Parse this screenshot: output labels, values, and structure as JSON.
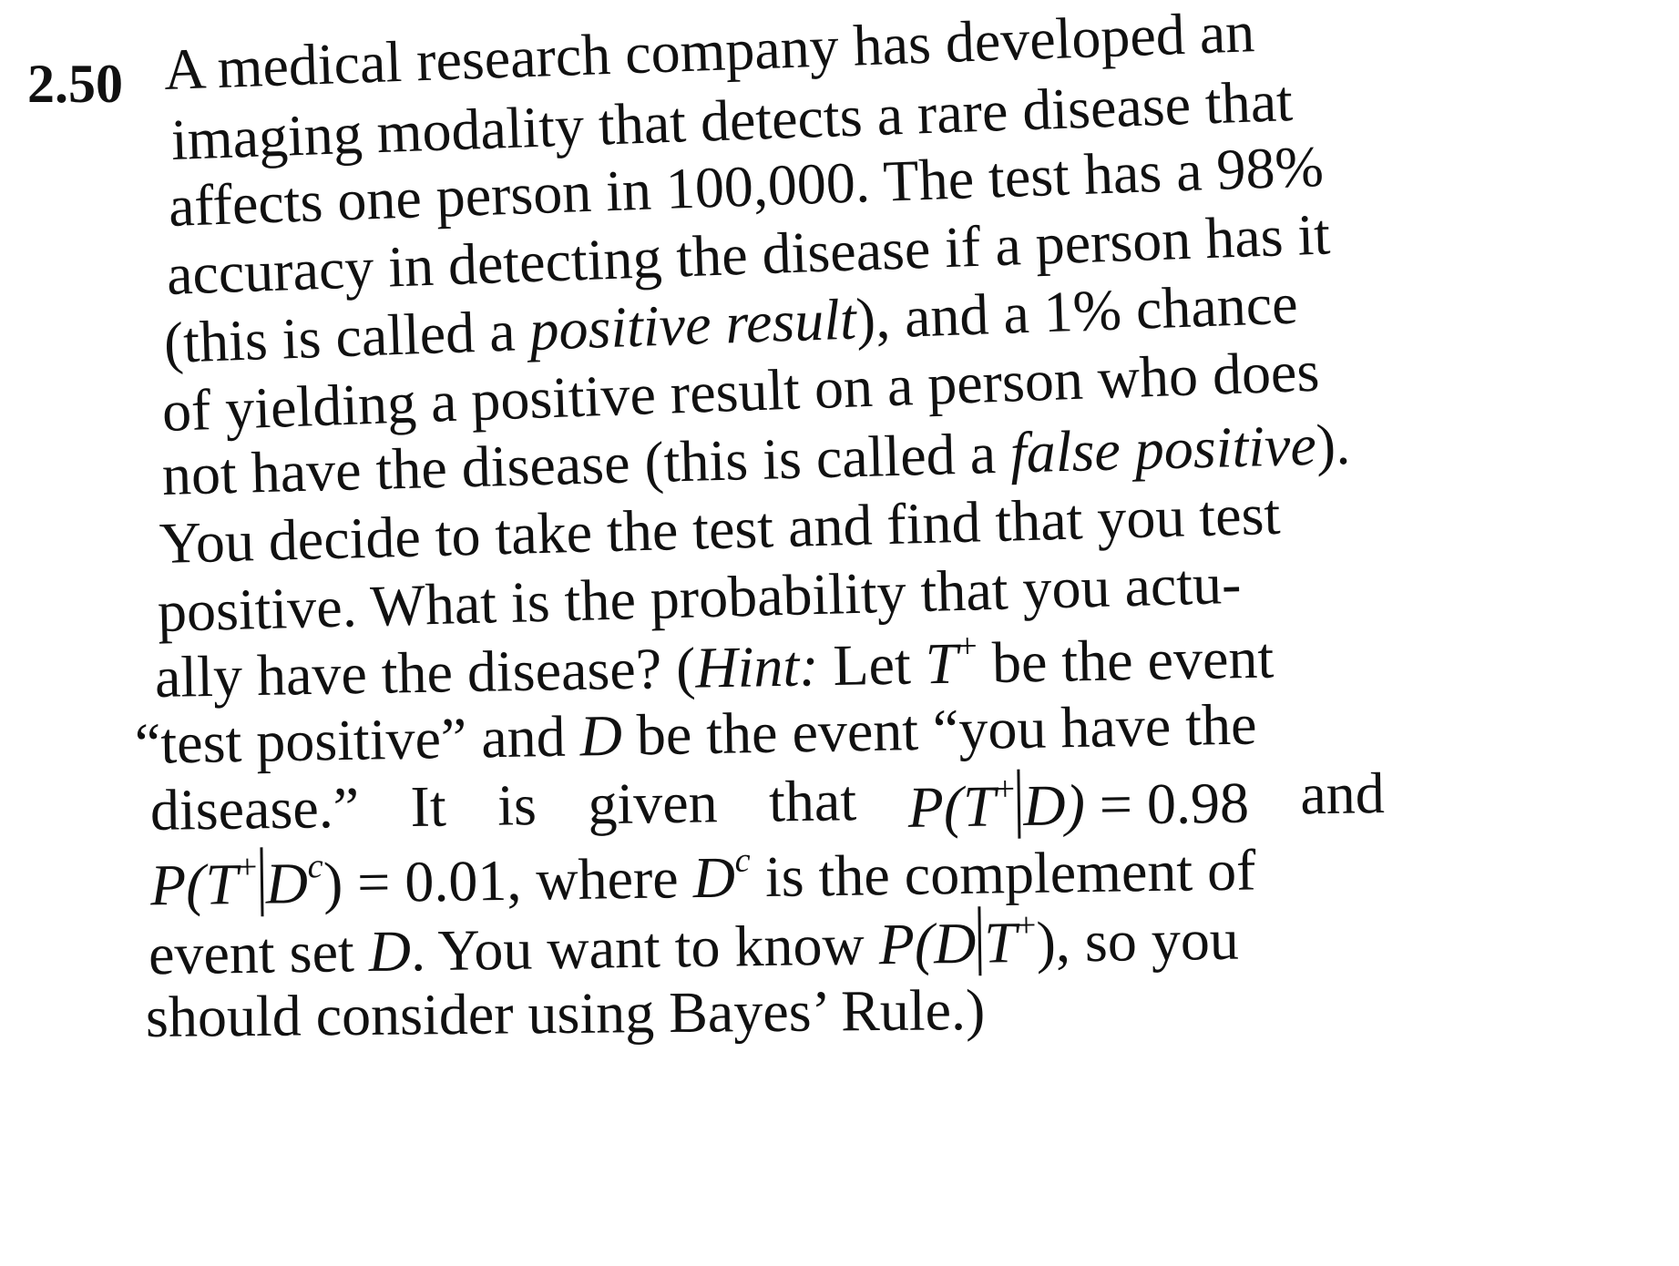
{
  "problem": {
    "number": "2.50",
    "lines": {
      "l1": "A medical research company has developed an",
      "l2": "imaging modality that detects a rare disease that",
      "l3": "affects one person in 100,000. The test has a 98%",
      "l4": "accuracy in detecting the disease if a person has it",
      "l5_a": "(this is called a ",
      "l5_b": "positive result",
      "l5_c": "), and a 1% chance",
      "l6": "of yielding a positive result on a person who does",
      "l7_a": "not have the disease (this is called a ",
      "l7_b": "false positive",
      "l7_c": ").",
      "l8": "You decide to take the test and find that you test",
      "l9": "positive. What is the probability that you actu-",
      "l10_a": "ally have the disease? (",
      "l10_b": "Hint:",
      "l10_c": " Let ",
      "l10_d": "T",
      "l10_e": "+",
      "l10_f": " be the event",
      "l11_a": "“test positive” and ",
      "l11_b": "D",
      "l11_c": " be the event “you have the",
      "l12_w1": "disease.”",
      "l12_w2": "It",
      "l12_w3": "is",
      "l12_w4": "given",
      "l12_w5": "that",
      "l12_f1": "P(T",
      "l12_f2": "+",
      "l12_f3": "D)",
      "l12_f4": "= 0.98",
      "l12_w6": "and",
      "l13_f1": "P(T",
      "l13_f2": "+",
      "l13_f3": "D",
      "l13_f4": "c",
      "l13_f5": ")",
      "l13_b": " = 0.01, where ",
      "l13_c": "D",
      "l13_d": "c",
      "l13_e": " is the complement of",
      "l14_a": "event set ",
      "l14_b": "D",
      "l14_c": ". You want to know ",
      "l14_f1": "P(D",
      "l14_f2": "T",
      "l14_f3": "+",
      "l14_f4": ")",
      "l14_d": ", so you",
      "l15": "should consider using Bayes’ Rule.)"
    }
  }
}
